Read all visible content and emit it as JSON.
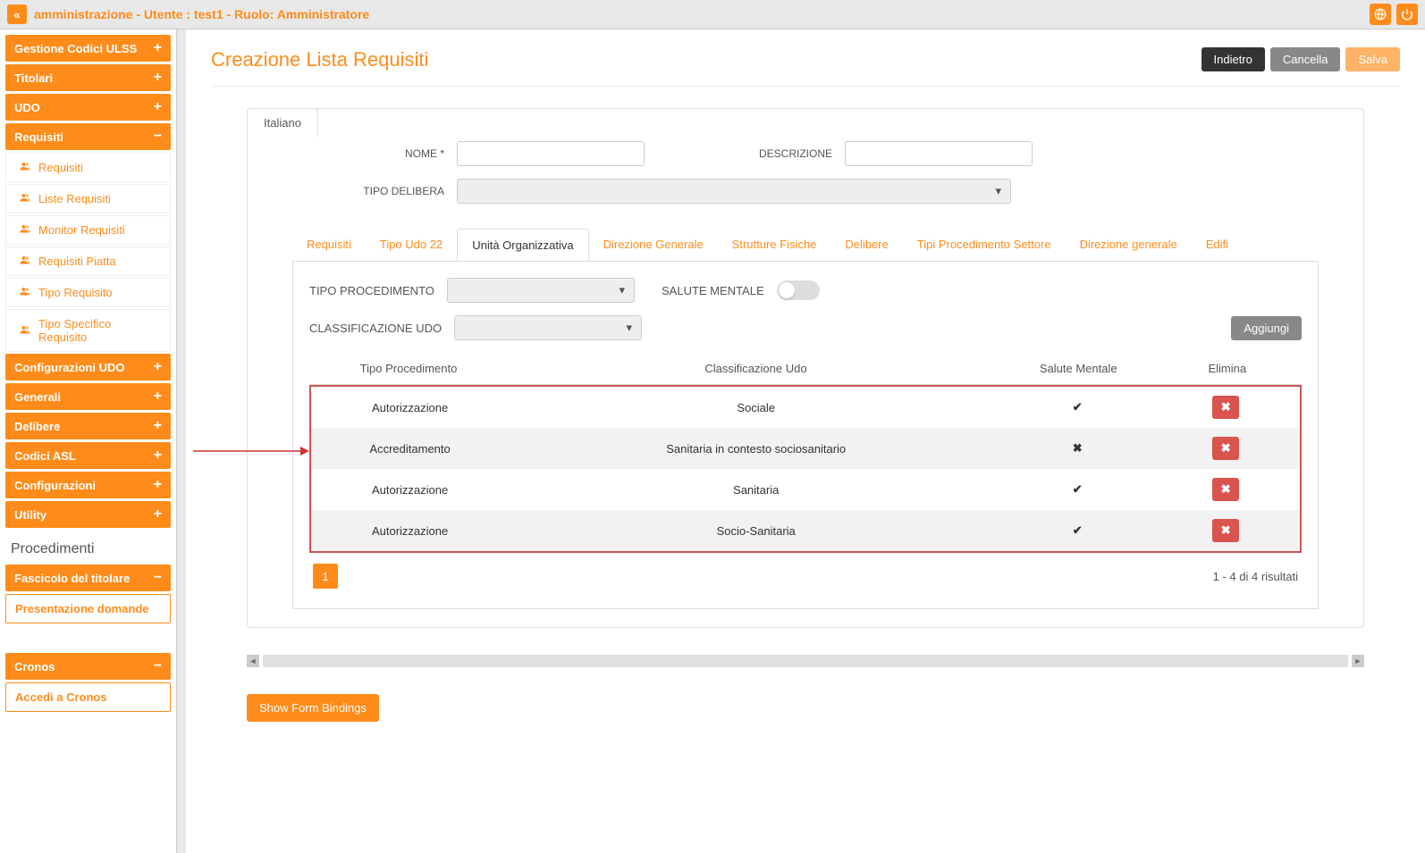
{
  "topbar": {
    "title": "amministrazione - Utente : test1 - Ruolo: Amministratore"
  },
  "sidebar": {
    "groups": [
      {
        "label": "Gestione Codici ULSS",
        "icon": "+"
      },
      {
        "label": "Titolari",
        "icon": "+"
      },
      {
        "label": "UDO",
        "icon": "+"
      }
    ],
    "requisiti": {
      "label": "Requisiti",
      "icon": "−",
      "items": [
        {
          "label": "Requisiti"
        },
        {
          "label": "Liste Requisiti"
        },
        {
          "label": "Monitor Requisiti"
        },
        {
          "label": "Requisiti Piatta"
        },
        {
          "label": "Tipo Requisito"
        },
        {
          "label": "Tipo Specifico Requisito"
        }
      ]
    },
    "groups2": [
      {
        "label": "Configurazioni UDO",
        "icon": "+"
      },
      {
        "label": "Generali",
        "icon": "+"
      },
      {
        "label": "Delibere",
        "icon": "+"
      },
      {
        "label": "Codici ASL",
        "icon": "+"
      },
      {
        "label": "Configurazioni",
        "icon": "+"
      },
      {
        "label": "Utility",
        "icon": "+"
      }
    ],
    "procedimenti": {
      "title": "Procedimenti",
      "fascicolo": {
        "label": "Fascicolo del titolare",
        "icon": "−"
      },
      "presentazione": "Presentazione domande",
      "cronos": {
        "label": "Cronos",
        "icon": "−"
      },
      "accedi": "Accedi a Cronos"
    }
  },
  "page": {
    "title": "Creazione Lista Requisiti",
    "buttons": {
      "back": "Indietro",
      "cancel": "Cancella",
      "save": "Salva"
    },
    "lang_tab": "Italiano",
    "form": {
      "nome_label": "NOME *",
      "descrizione_label": "DESCRIZIONE",
      "tipo_delibera_label": "TIPO DELIBERA"
    },
    "tabs": [
      "Requisiti",
      "Tipo Udo 22",
      "Unità Organizzativa",
      "Direzione Generale",
      "Strutture Fisiche",
      "Delibere",
      "Tipi Procedimento Settore",
      "Direzione generale",
      "Edifi"
    ],
    "active_tab": 2,
    "filters": {
      "tipo_proc_label": "TIPO PROCEDIMENTO",
      "salute_label": "SALUTE MENTALE",
      "classificazione_label": "CLASSIFICAZIONE UDO",
      "aggiungi": "Aggiungi"
    },
    "table": {
      "headers": [
        "Tipo Procedimento",
        "Classificazione Udo",
        "Salute Mentale",
        "Elimina"
      ],
      "rows": [
        {
          "tipo": "Autorizzazione",
          "class": "Sociale",
          "salute": true
        },
        {
          "tipo": "Accreditamento",
          "class": "Sanitaria in contesto sociosanitario",
          "salute": false
        },
        {
          "tipo": "Autorizzazione",
          "class": "Sanitaria",
          "salute": true
        },
        {
          "tipo": "Autorizzazione",
          "class": "Socio-Sanitaria",
          "salute": true
        }
      ]
    },
    "pager": {
      "page": "1",
      "info": "1 - 4 di 4 risultati"
    },
    "show_bindings": "Show Form Bindings"
  }
}
